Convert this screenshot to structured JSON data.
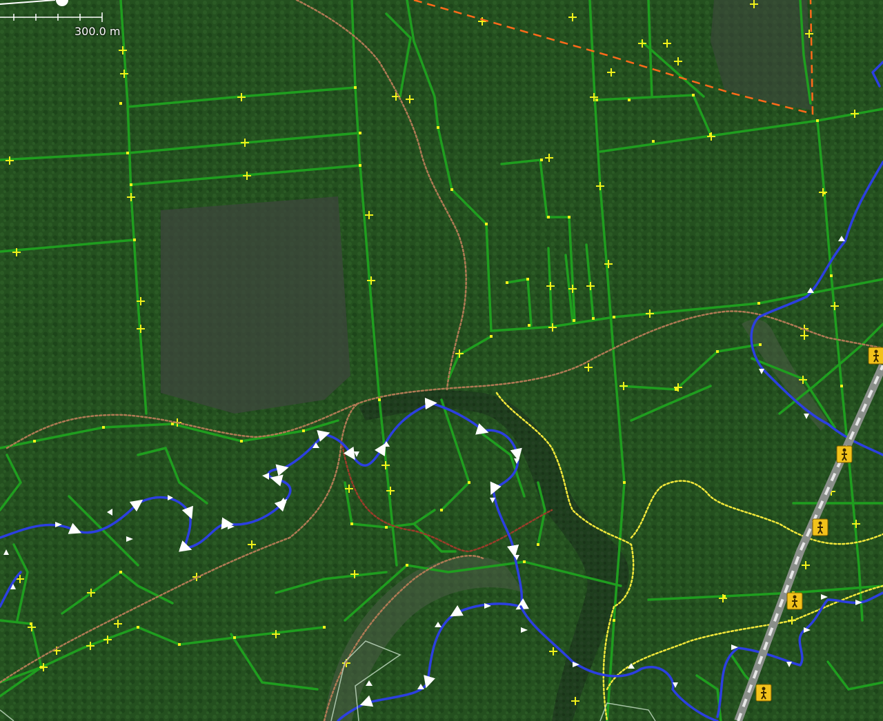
{
  "map": {
    "scale_label": "300.0 m",
    "colors": {
      "imagery_base": "#24501f",
      "imagery_dark": "#1a3a1a",
      "clearing": "#3a4a3a",
      "path_green": "#1f9e1f",
      "node_yellow": "#f2f21a",
      "river_blue": "#2c3fe0",
      "track_brown": "#b07a55",
      "track_red": "#9b3b2a",
      "boundary_orange": "#ff6a1a",
      "trail_yellow": "#f2e83a",
      "marker_bg": "#f2c21a"
    },
    "markers": [
      {
        "name": "hiker-icon",
        "label": "hiker"
      },
      {
        "name": "hiker-icon",
        "label": "hiker"
      },
      {
        "name": "hiker-icon",
        "label": "hiker"
      },
      {
        "name": "hiker-icon",
        "label": "hiker"
      },
      {
        "name": "hiker-icon",
        "label": "hiker"
      }
    ]
  }
}
